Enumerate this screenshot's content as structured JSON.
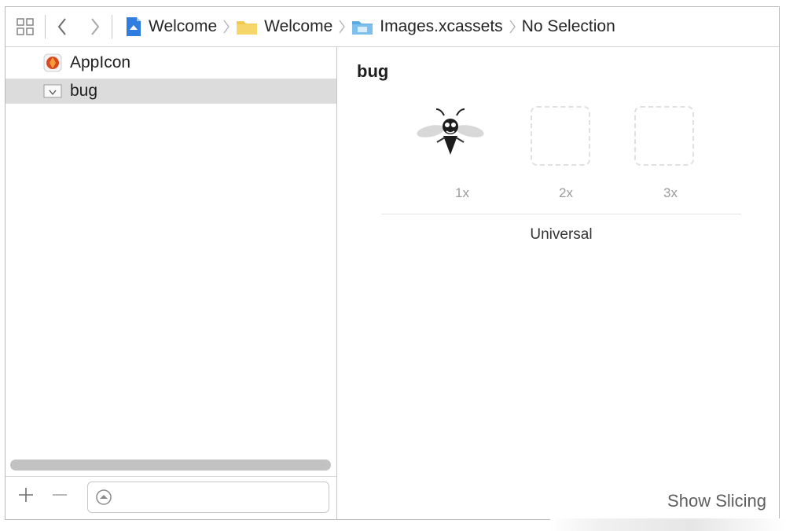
{
  "breadcrumb": [
    {
      "label": "Welcome",
      "icon": "project-file-icon"
    },
    {
      "label": "Welcome",
      "icon": "folder-icon"
    },
    {
      "label": "Images.xcassets",
      "icon": "asset-catalog-folder-icon"
    },
    {
      "label": "No Selection",
      "icon": ""
    }
  ],
  "assets": [
    {
      "name": "AppIcon",
      "icon": "app-icon-set-icon",
      "selected": false
    },
    {
      "name": "bug",
      "icon": "image-set-icon",
      "selected": true
    }
  ],
  "detail": {
    "title": "bug",
    "scales": [
      "1x",
      "2x",
      "3x"
    ],
    "idiom": "Universal",
    "show_slicing": "Show Slicing"
  },
  "filter": {
    "value": "",
    "placeholder": ""
  },
  "colors": {
    "selection": "#dcdcdc",
    "folder": "#f2c94c",
    "folder_blue": "#6ab8e8"
  }
}
